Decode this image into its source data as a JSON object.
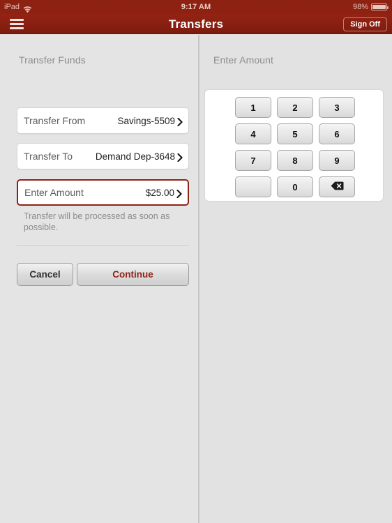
{
  "status_bar": {
    "device": "iPad",
    "wifi_icon": "wifi-icon",
    "time": "9:17 AM",
    "battery_percent": "98%",
    "battery_icon": "battery-icon"
  },
  "nav_bar": {
    "menu_icon": "hamburger-menu-icon",
    "title": "Transfers",
    "sign_off_label": "Sign Off"
  },
  "left_pane": {
    "section_label": "Transfer Funds",
    "rows": [
      {
        "label": "Transfer From",
        "value": "Savings-5509",
        "chevron_icon": "chevron-right-icon",
        "selected": false
      },
      {
        "label": "Transfer To",
        "value": "Demand Dep-3648",
        "chevron_icon": "chevron-right-icon",
        "selected": false
      },
      {
        "label": "Enter Amount",
        "value": "$25.00",
        "chevron_icon": "chevron-right-icon",
        "selected": true
      }
    ],
    "helper_text": "Transfer will be processed as soon as possible.",
    "cancel_label": "Cancel",
    "continue_label": "Continue"
  },
  "right_pane": {
    "section_label": "Enter Amount",
    "keypad": [
      {
        "label": "1",
        "name": "key-1"
      },
      {
        "label": "2",
        "name": "key-2"
      },
      {
        "label": "3",
        "name": "key-3"
      },
      {
        "label": "4",
        "name": "key-4"
      },
      {
        "label": "5",
        "name": "key-5"
      },
      {
        "label": "6",
        "name": "key-6"
      },
      {
        "label": "7",
        "name": "key-7"
      },
      {
        "label": "8",
        "name": "key-8"
      },
      {
        "label": "9",
        "name": "key-9"
      },
      {
        "label": "",
        "name": "key-blank"
      },
      {
        "label": "0",
        "name": "key-0"
      },
      {
        "label": "",
        "name": "key-backspace",
        "icon": "backspace-icon"
      }
    ]
  },
  "colors": {
    "brand_red": "#8e2416",
    "nav_bar": "#8a2011",
    "page_background": "#e4e4e4",
    "card_white": "#ffffff",
    "label_gray": "#8c8c8c"
  }
}
